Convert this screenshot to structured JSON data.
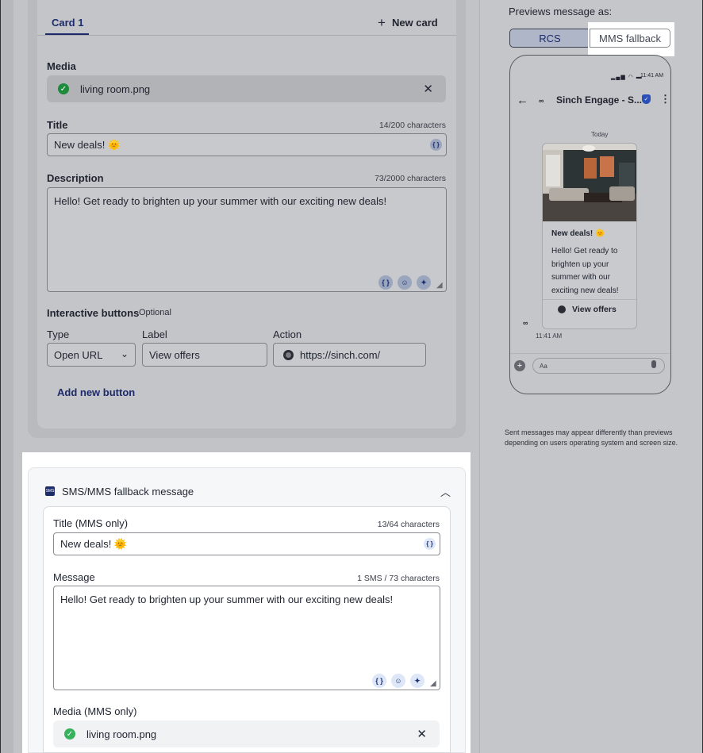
{
  "card_editor": {
    "tabs": {
      "active": "Card 1",
      "new_card": "New card"
    },
    "media": {
      "label": "Media",
      "file": "living room.png"
    },
    "title": {
      "label": "Title",
      "counter": "14/200 characters",
      "value": "New deals! 🌞"
    },
    "description": {
      "label": "Description",
      "counter": "73/2000 characters",
      "value": "Hello! Get ready to brighten up your summer with our exciting new deals!"
    },
    "buttons": {
      "label": "Interactive buttons",
      "optional": "Optional",
      "type_label": "Type",
      "label_label": "Label",
      "action_label": "Action",
      "type_value": "Open URL",
      "label_value": "View offers",
      "action_value": "https://sinch.com/",
      "add": "Add new button"
    }
  },
  "fallback": {
    "header": "SMS/MMS fallback message",
    "title": {
      "label": "Title (MMS only)",
      "counter": "13/64 characters",
      "value": "New deals! 🌞"
    },
    "message": {
      "label": "Message",
      "counter": "1 SMS / 73 characters",
      "value": "Hello! Get ready to brighten up your summer with our exciting new deals!"
    },
    "media": {
      "label": "Media (MMS only)",
      "file": "living room.png"
    }
  },
  "preview": {
    "label": "Previews message as:",
    "toggle": {
      "rcs": "RCS",
      "mms": "MMS fallback"
    },
    "phone": {
      "time": "11:41 AM",
      "sender": "Sinch Engage - S...",
      "date": "Today",
      "card_title": "New deals! 🌞",
      "card_body": "Hello! Get ready to brighten up your summer with our exciting new deals!",
      "card_button": "View offers",
      "msg_time": "11:41 AM",
      "compose_placeholder": "Aa"
    },
    "disclaimer": "Sent messages may appear differently than previews depending on users operating system and screen size."
  },
  "colors": {
    "brand_navy": "#1c2b6b",
    "success_green": "#37b15c",
    "overlay_gray": "#c4c5c8"
  }
}
